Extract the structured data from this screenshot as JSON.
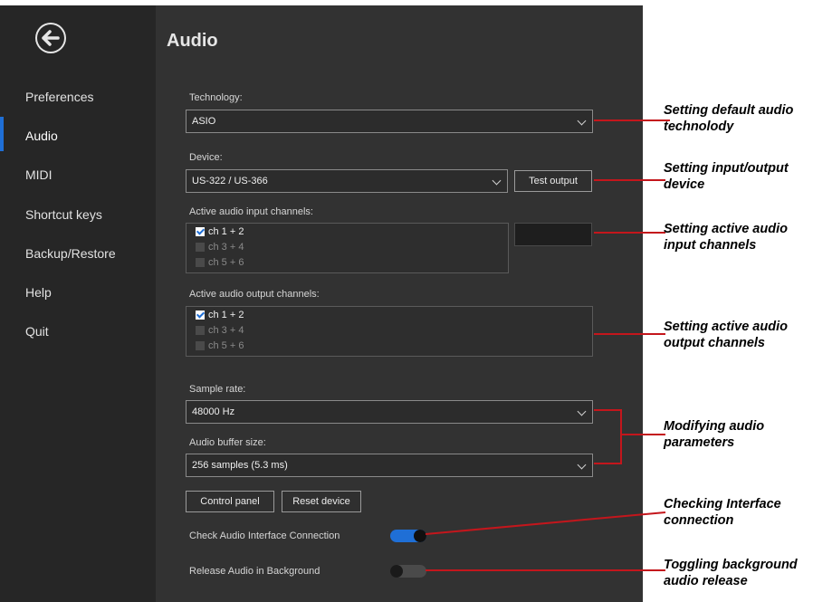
{
  "nav": {
    "back_icon": "back-arrow-icon",
    "items": [
      {
        "label": "Preferences"
      },
      {
        "label": "Audio"
      },
      {
        "label": "MIDI"
      },
      {
        "label": "Shortcut keys"
      },
      {
        "label": "Backup/Restore"
      },
      {
        "label": "Help"
      },
      {
        "label": "Quit"
      }
    ],
    "active": "Audio"
  },
  "page": {
    "title": "Audio"
  },
  "technology": {
    "label": "Technology:",
    "value": "ASIO"
  },
  "device": {
    "label": "Device:",
    "value": "US-322 / US-366",
    "test_button": "Test output"
  },
  "input_channels": {
    "label": "Active audio input channels:",
    "items": [
      {
        "label": "ch 1 + 2",
        "checked": true
      },
      {
        "label": "ch 3 + 4",
        "checked": false
      },
      {
        "label": "ch 5 + 6",
        "checked": false
      }
    ]
  },
  "output_channels": {
    "label": "Active audio output channels:",
    "items": [
      {
        "label": "ch 1 + 2",
        "checked": true
      },
      {
        "label": "ch 3 + 4",
        "checked": false
      },
      {
        "label": "ch 5 + 6",
        "checked": false
      }
    ]
  },
  "sample_rate": {
    "label": "Sample rate:",
    "value": "48000 Hz"
  },
  "buffer_size": {
    "label": "Audio buffer size:",
    "value": "256 samples (5.3 ms)"
  },
  "buttons": {
    "control_panel": "Control panel",
    "reset_device": "Reset device"
  },
  "toggles": {
    "check_connection": {
      "label": "Check Audio Interface Connection",
      "on": true
    },
    "release_background": {
      "label": "Release Audio in Background",
      "on": false
    }
  },
  "annotations": {
    "technology": [
      "Setting default audio",
      "technolody"
    ],
    "device": [
      "Setting input/output",
      "device"
    ],
    "input": [
      "Setting active audio",
      "input channels"
    ],
    "output": [
      "Setting active audio",
      "output channels"
    ],
    "params": [
      "Modifying audio",
      "parameters"
    ],
    "connection": [
      "Checking Interface",
      "connection"
    ],
    "background": [
      "Toggling background",
      "audio release"
    ]
  },
  "colors": {
    "accent": "#1f6fd6",
    "annotation_line": "#c4161c",
    "sidebar": "#262626",
    "panel": "#323232"
  }
}
